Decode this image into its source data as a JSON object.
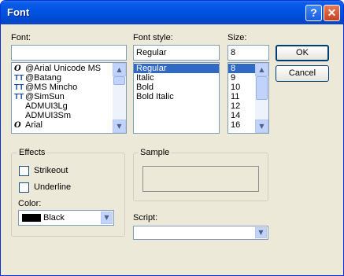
{
  "window": {
    "title": "Font",
    "help_glyph": "?",
    "close_glyph": "✕"
  },
  "font": {
    "label": "Font:",
    "value": "",
    "items": [
      {
        "icon": "opentype-icon",
        "glyph": "O",
        "name": "@Arial Unicode MS"
      },
      {
        "icon": "truetype-icon",
        "glyph": "TT",
        "name": "@Batang"
      },
      {
        "icon": "truetype-icon",
        "glyph": "TT",
        "name": "@MS Mincho"
      },
      {
        "icon": "truetype-icon",
        "glyph": "TT",
        "name": "@SimSun"
      },
      {
        "icon": "",
        "glyph": "",
        "name": "ADMUI3Lg"
      },
      {
        "icon": "",
        "glyph": "",
        "name": "ADMUI3Sm"
      },
      {
        "icon": "opentype-icon",
        "glyph": "O",
        "name": "Arial"
      }
    ]
  },
  "style": {
    "label": "Font style:",
    "value": "Regular",
    "items": [
      "Regular",
      "Italic",
      "Bold",
      "Bold Italic"
    ],
    "selected": "Regular"
  },
  "size": {
    "label": "Size:",
    "value": "8",
    "items": [
      "8",
      "9",
      "10",
      "11",
      "12",
      "14",
      "16"
    ],
    "selected": "8"
  },
  "buttons": {
    "ok": "OK",
    "cancel": "Cancel"
  },
  "effects": {
    "label": "Effects",
    "strikeout": "Strikeout",
    "underline": "Underline",
    "color_label": "Color:",
    "color_value": "Black",
    "color_swatch": "#000000"
  },
  "sample": {
    "label": "Sample",
    "text": ""
  },
  "script": {
    "label": "Script:",
    "value": ""
  }
}
